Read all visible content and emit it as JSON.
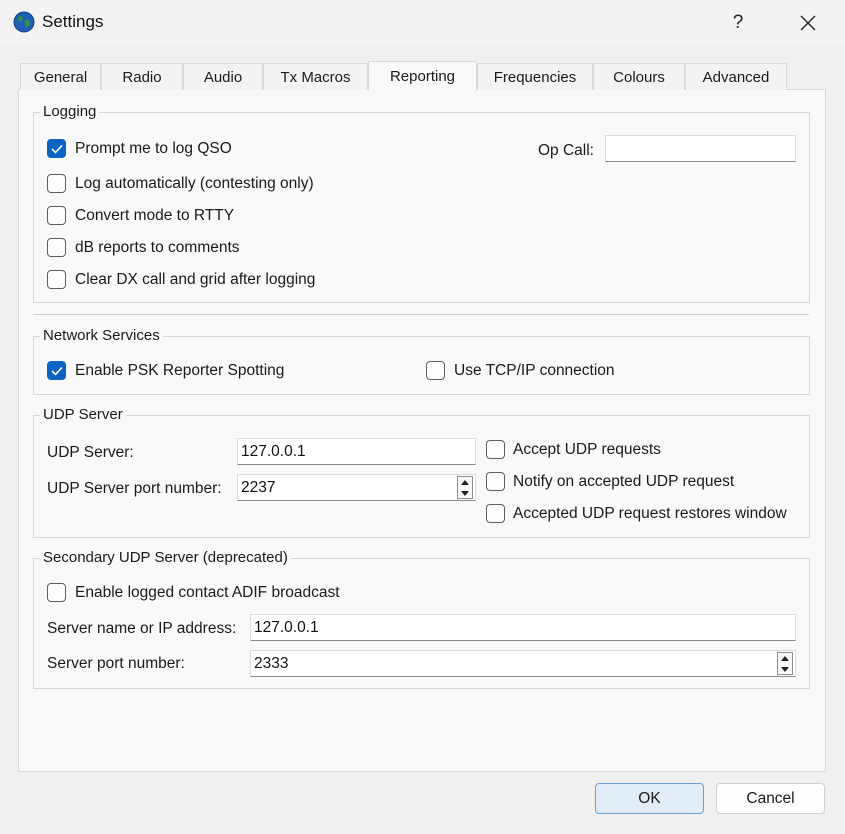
{
  "window": {
    "title": "Settings",
    "help_label": "?"
  },
  "tabs": [
    {
      "label": "General",
      "active": false
    },
    {
      "label": "Radio",
      "active": false
    },
    {
      "label": "Audio",
      "active": false
    },
    {
      "label": "Tx Macros",
      "active": false
    },
    {
      "label": "Reporting",
      "active": true
    },
    {
      "label": "Frequencies",
      "active": false
    },
    {
      "label": "Colours",
      "active": false
    },
    {
      "label": "Advanced",
      "active": false
    }
  ],
  "logging": {
    "title": "Logging",
    "prompt_log": {
      "label": "Prompt me to log QSO",
      "checked": true
    },
    "log_auto": {
      "label": "Log automatically (contesting only)",
      "checked": false
    },
    "convert_rtty": {
      "label": "Convert mode to RTTY",
      "checked": false
    },
    "db_reports": {
      "label": "dB reports to comments",
      "checked": false
    },
    "clear_dx": {
      "label": "Clear DX call and grid after logging",
      "checked": false
    },
    "op_call_label": "Op Call:",
    "op_call_value": ""
  },
  "network": {
    "title": "Network Services",
    "psk": {
      "label": "Enable PSK Reporter Spotting",
      "checked": true
    },
    "tcp": {
      "label": "Use TCP/IP connection",
      "checked": false
    }
  },
  "udp": {
    "title": "UDP Server",
    "server_label": "UDP Server:",
    "server_value": "127.0.0.1",
    "port_label": "UDP Server port number:",
    "port_value": "2237",
    "accept": {
      "label": "Accept UDP requests",
      "checked": false
    },
    "notify": {
      "label": "Notify on accepted UDP request",
      "checked": false
    },
    "restore": {
      "label": "Accepted UDP request restores window",
      "checked": false
    }
  },
  "secondary": {
    "title": "Secondary UDP Server (deprecated)",
    "adif": {
      "label": "Enable logged contact ADIF broadcast",
      "checked": false
    },
    "name_label": "Server name or IP address:",
    "name_value": "127.0.0.1",
    "port_label": "Server port number:",
    "port_value": "2333"
  },
  "buttons": {
    "ok": "OK",
    "cancel": "Cancel"
  },
  "colors": {
    "accent": "#0a64c2",
    "default_button": "#e1ecf7"
  }
}
